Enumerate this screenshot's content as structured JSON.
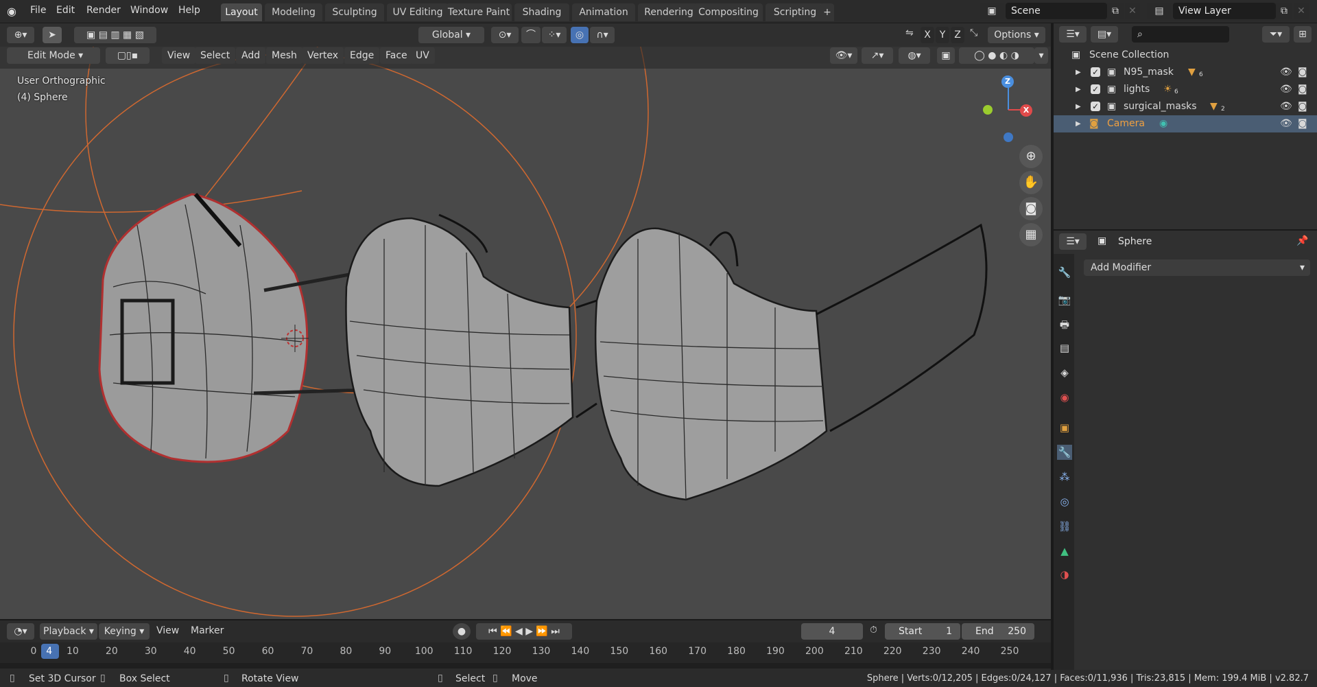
{
  "topbar": {
    "menus": [
      "File",
      "Edit",
      "Render",
      "Window",
      "Help"
    ],
    "workspaces": [
      "Layout",
      "Modeling",
      "Sculpting",
      "UV Editing",
      "Texture Paint",
      "Shading",
      "Animation",
      "Rendering",
      "Compositing",
      "Scripting"
    ],
    "add_tab": "+",
    "scene_label": "Scene",
    "view_layer_label": "View Layer"
  },
  "toolbar": {
    "transform_orientation": "Global",
    "options_label": "Options",
    "axes": [
      "X",
      "Y",
      "Z"
    ]
  },
  "viewport_header": {
    "mode": "Edit Mode",
    "menus": [
      "View",
      "Select",
      "Add",
      "Mesh",
      "Vertex",
      "Edge",
      "Face",
      "UV"
    ]
  },
  "viewport": {
    "view_name": "User Orthographic",
    "object_info": "(4) Sphere",
    "gizmo": {
      "z": "Z",
      "x": "X"
    }
  },
  "outliner": {
    "root": "Scene Collection",
    "items": [
      {
        "name": "N95_mask",
        "badge": "6"
      },
      {
        "name": "lights",
        "badge": "6"
      },
      {
        "name": "surgical_masks",
        "badge": "2"
      },
      {
        "name": "Camera",
        "badge": ""
      }
    ]
  },
  "properties": {
    "object_name": "Sphere",
    "add_modifier": "Add Modifier"
  },
  "timeline": {
    "menus": [
      "Playback",
      "Keying",
      "View",
      "Marker"
    ],
    "current_frame": "4",
    "start_label": "Start",
    "start": "1",
    "end_label": "End",
    "end": "250",
    "ticks": [
      "0",
      "4",
      "10",
      "20",
      "30",
      "40",
      "50",
      "60",
      "70",
      "80",
      "90",
      "100",
      "110",
      "120",
      "130",
      "140",
      "150",
      "160",
      "170",
      "180",
      "190",
      "200",
      "210",
      "220",
      "230",
      "240",
      "250"
    ]
  },
  "statusbar": {
    "hints": [
      "Set 3D Cursor",
      "Box Select",
      "Rotate View",
      "Select",
      "Move"
    ],
    "stats": "Sphere | Verts:0/12,205 | Edges:0/24,127 | Faces:0/11,936 | Tris:23,815 | Mem: 199.4 MiB | v2.82.7"
  },
  "colors": {
    "accent": "#4772b3",
    "selected_row": "#4a5d73",
    "camera_text": "#f0a040",
    "orange_circle": "#e06020"
  }
}
